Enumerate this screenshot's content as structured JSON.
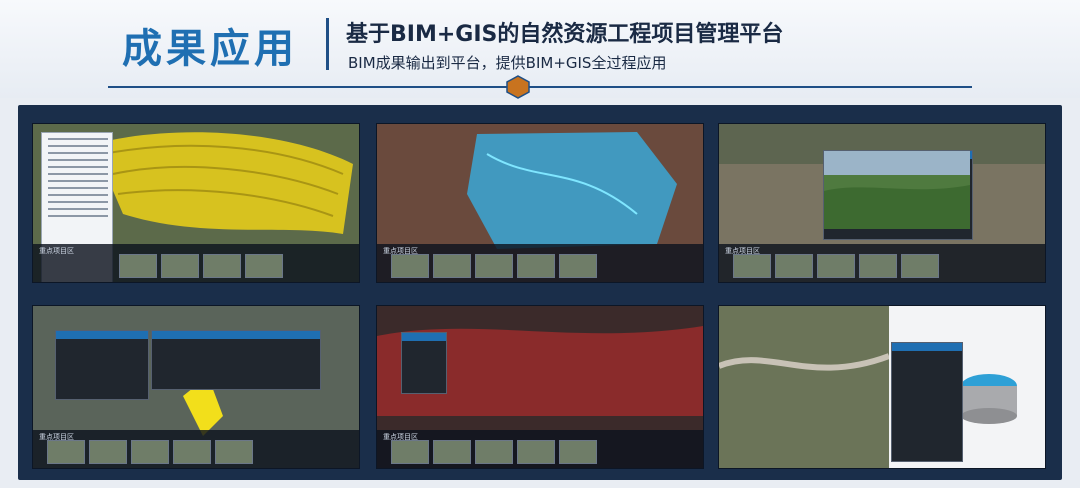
{
  "header": {
    "title": "成果应用",
    "subtitle": "基于BIM+GIS的自然资源工程项目管理平台",
    "description": "BIM成果输出到平台，提供BIM+GIS全过程应用"
  },
  "colors": {
    "accent": "#1f6fb2",
    "panel": "#1a2e4a",
    "hexagon": "#c8731f"
  },
  "screens": [
    {
      "name": "yellow-terraced-hillside",
      "bar_caption": "重点项目区",
      "has_tree": true
    },
    {
      "name": "blue-water-overlay",
      "bar_caption": "重点项目区"
    },
    {
      "name": "terraces-photo-dialog",
      "bar_caption": "重点项目区"
    },
    {
      "name": "satellite-charts-dialog",
      "bar_caption": "重点项目区"
    },
    {
      "name": "red-terrain-settings",
      "bar_caption": "重点项目区"
    },
    {
      "name": "bim-tank-model"
    }
  ]
}
